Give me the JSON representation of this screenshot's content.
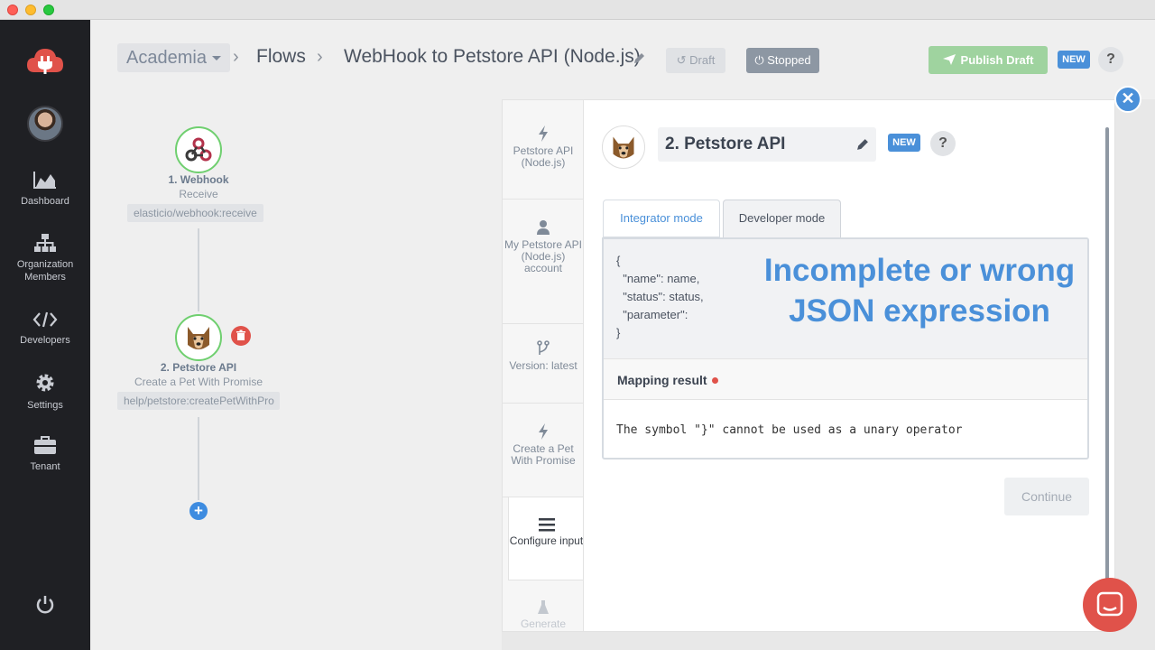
{
  "header": {
    "workspace": "Academia",
    "crumbs": [
      "Flows",
      "WebHook to Petstore API (Node.js)"
    ],
    "draft_label": "Draft",
    "stopped_label": "Stopped",
    "publish_label": "Publish Draft",
    "new_badge": "NEW",
    "help": "?"
  },
  "sidebar": {
    "items": [
      {
        "label": "Dashboard",
        "icon": "chart-icon"
      },
      {
        "label": "Organization Members",
        "icon": "org-tree-icon"
      },
      {
        "label": "Developers",
        "icon": "code-icon"
      },
      {
        "label": "Settings",
        "icon": "gear-icon"
      },
      {
        "label": "Tenant",
        "icon": "briefcase-icon"
      }
    ]
  },
  "flow": {
    "nodes": [
      {
        "title": "1. Webhook",
        "subtitle": "Receive",
        "path": "elasticio/webhook:receive"
      },
      {
        "title": "2. Petstore API",
        "subtitle": "Create a Pet With Promise",
        "path": "help/petstore:createPetWithPro"
      }
    ],
    "add_symbol": "+"
  },
  "steps": [
    {
      "label": "Petstore API (Node.js)"
    },
    {
      "label": "My Petstore API (Node.js) account"
    },
    {
      "label": "Version: latest"
    },
    {
      "label": "Create a Pet With Promise"
    },
    {
      "label": "Configure input"
    },
    {
      "label": "Generate sample"
    }
  ],
  "panel": {
    "component_name": "2. Petstore API",
    "new_badge": "NEW",
    "help": "?",
    "tabs": [
      "Integrator mode",
      "Developer mode"
    ],
    "code_lines": [
      "{",
      "  \"name\": name,",
      "  \"status\": status,",
      "  \"parameter\":",
      "}"
    ],
    "overlay_line1": "Incomplete or wrong",
    "overlay_line2": "JSON expression",
    "mapping_result_label": "Mapping result",
    "mapping_result_message": "The symbol \"}\" cannot be used as a unary operator",
    "continue_label": "Continue",
    "close_symbol": "✕"
  },
  "colors": {
    "accent": "#4a90d9",
    "success": "#6fcf6f",
    "danger": "#e0524a",
    "sidebar_bg": "#1f2024"
  }
}
